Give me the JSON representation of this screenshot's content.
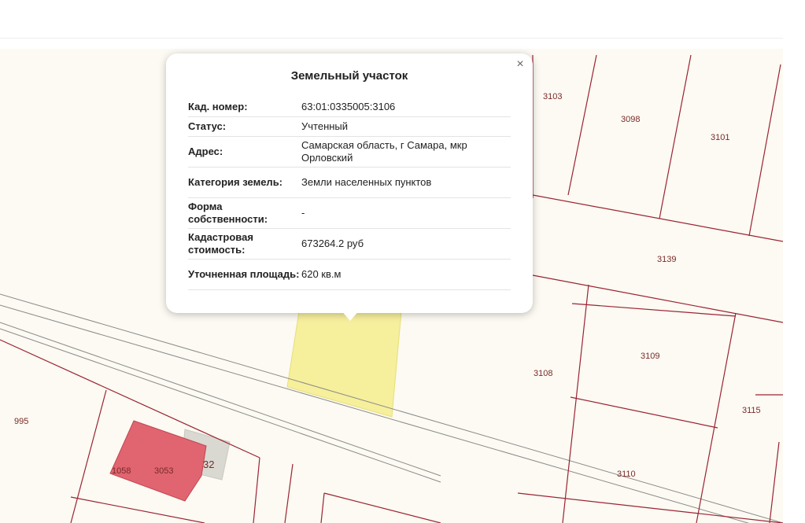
{
  "popup": {
    "title": "Земельный участок",
    "close_symbol": "×",
    "rows": [
      {
        "label": "Кад. номер:",
        "value": "63:01:0335005:3106"
      },
      {
        "label": "Статус:",
        "value": "Учтенный"
      },
      {
        "label": "Адрес:",
        "value": "Самарская область, г Самара, мкр Орловский"
      },
      {
        "label": "Категория земель:",
        "value": "Земли населенных пунктов"
      },
      {
        "label": "Форма собственности:",
        "value": "-"
      },
      {
        "label": "Кадастровая стоимость:",
        "value": "673264.2 руб"
      },
      {
        "label": "Уточненная площадь:",
        "value": "620 кв.м"
      }
    ]
  },
  "map": {
    "colors": {
      "background": "#fcfaf2",
      "boundary": "#9b2335",
      "selected_parcel": "#f6ef9c",
      "building": "#e06570",
      "road": "#8a8a8a"
    },
    "parcel_labels": [
      "3103",
      "3098",
      "3101",
      "3139",
      "3109",
      "3108",
      "3115",
      "3110",
      "995",
      "1058",
      "3053",
      "32"
    ]
  }
}
